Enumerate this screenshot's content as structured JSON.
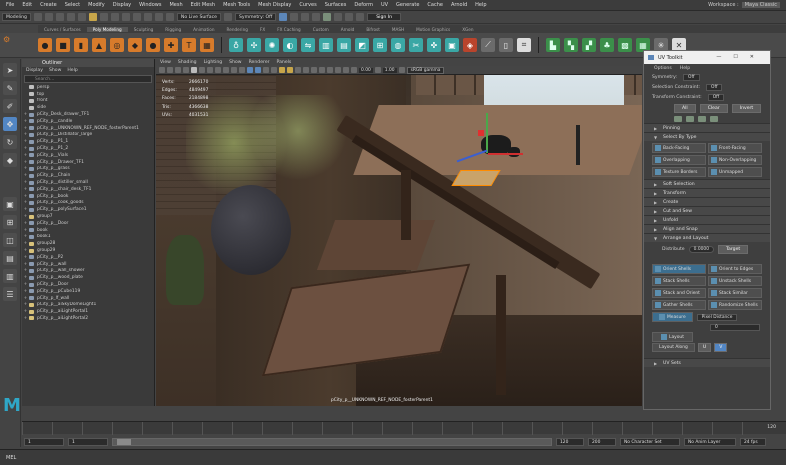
{
  "app": {
    "name": "Maya"
  },
  "menubar": [
    "File",
    "Edit",
    "Create",
    "Select",
    "Modify",
    "Display",
    "Windows",
    "Mesh",
    "Edit Mesh",
    "Mesh Tools",
    "Mesh Display",
    "Curves",
    "Surfaces",
    "Deform",
    "UV",
    "Generate",
    "Cache",
    "Arnold",
    "Help"
  ],
  "workspace": {
    "label": "Workspace :",
    "value": "Maya Classic"
  },
  "statusline": {
    "mode": "Modeling",
    "surface_mode": "No Live Surface",
    "symmetry": "Symmetry: Off",
    "sign_in": "Sign In"
  },
  "shelf": {
    "tabs": [
      "Curves / Surfaces",
      "Poly Modeling",
      "Sculpting",
      "Rigging",
      "Animation",
      "Rendering",
      "FX",
      "FX Caching",
      "Custom",
      "Arnold",
      "Bifrost",
      "MASH",
      "Motion Graphics",
      "XGen"
    ],
    "active_tab": "Poly Modeling"
  },
  "outliner": {
    "title": "Outliner",
    "menu": [
      "Display",
      "Show",
      "Help"
    ],
    "search_placeholder": "Search...",
    "items": [
      {
        "label": "persp",
        "type": "cam",
        "sel": false
      },
      {
        "label": "top",
        "type": "cam",
        "sel": false
      },
      {
        "label": "front",
        "type": "cam",
        "sel": false
      },
      {
        "label": "side",
        "type": "cam",
        "sel": false
      },
      {
        "label": "pCity_Desk_drawer_TF1",
        "type": "mesh",
        "sel": false
      },
      {
        "label": "pCity_p__candle",
        "type": "mesh",
        "sel": false
      },
      {
        "label": "pCity_p__UNKNOWN_REF_NODE_fosterParent1",
        "type": "mesh",
        "sel": false
      },
      {
        "label": "pCity_p__Distillator_large",
        "type": "mesh",
        "sel": false
      },
      {
        "label": "pCity_p__P1_1",
        "type": "mesh",
        "sel": false
      },
      {
        "label": "pCity_p__P1_2",
        "type": "mesh",
        "sel": false
      },
      {
        "label": "pCity_p__Vials",
        "type": "mesh",
        "sel": false
      },
      {
        "label": "pCity_p__Drawer_TF1",
        "type": "mesh",
        "sel": false
      },
      {
        "label": "pCity_p__grass",
        "type": "mesh",
        "sel": false
      },
      {
        "label": "pCity_p__Chain",
        "type": "mesh",
        "sel": false
      },
      {
        "label": "pCity_p__distiller_small",
        "type": "mesh",
        "sel": false
      },
      {
        "label": "pCity_p__chair_desk_TF1",
        "type": "mesh",
        "sel": false
      },
      {
        "label": "pCity_p__book",
        "type": "mesh",
        "sel": false
      },
      {
        "label": "pCity_p__cook_goods",
        "type": "mesh",
        "sel": false
      },
      {
        "label": "pCity_p__polySurface1",
        "type": "mesh",
        "sel": false
      },
      {
        "label": "group7",
        "type": "grp",
        "sel": false
      },
      {
        "label": "pCity_p__Door",
        "type": "mesh",
        "sel": false
      },
      {
        "label": "book",
        "type": "mesh",
        "sel": false
      },
      {
        "label": "book1",
        "type": "mesh",
        "sel": false
      },
      {
        "label": "group28",
        "type": "grp",
        "sel": false
      },
      {
        "label": "group29",
        "type": "grp",
        "sel": false
      },
      {
        "label": "pCity_p__P2",
        "type": "mesh",
        "sel": false
      },
      {
        "label": "pCity_p__wall",
        "type": "mesh",
        "sel": false
      },
      {
        "label": "pCity_p__wall_shower",
        "type": "mesh",
        "sel": false
      },
      {
        "label": "pCity_p__wood_plate",
        "type": "mesh",
        "sel": false
      },
      {
        "label": "pCity_p__Door",
        "type": "mesh",
        "sel": false
      },
      {
        "label": "pCity_p__pCube119",
        "type": "mesh",
        "sel": false
      },
      {
        "label": "pCity_p_lf_wall",
        "type": "mesh",
        "sel": false
      },
      {
        "label": "pCity_p__aiSkyDomeLight1",
        "type": "grp",
        "sel": false
      },
      {
        "label": "pCity_p__aiLightPortal1",
        "type": "grp",
        "sel": false
      },
      {
        "label": "pCity_p__aiLightPortal2",
        "type": "grp",
        "sel": false
      }
    ]
  },
  "viewport": {
    "menu": [
      "View",
      "Shading",
      "Lighting",
      "Show",
      "Renderer",
      "Panels"
    ],
    "hud": [
      {
        "label": "Verts:",
        "value": "2666170"
      },
      {
        "label": "Edges:",
        "value": "4849497"
      },
      {
        "label": "Faces:",
        "value": "2184898"
      },
      {
        "label": "Tris:",
        "value": "4366638"
      },
      {
        "label": "UVs:",
        "value": "4031531"
      }
    ],
    "field_a": "0.00",
    "field_b": "1.00",
    "color_space": "sRGB gamma",
    "caption": "pCity_p__UNKNOWN_REF_NODE_fosterParent1"
  },
  "uv_toolkit": {
    "title": "UV Toolkit",
    "menu": [
      "Options",
      "Help"
    ],
    "symmetry": {
      "label": "Symmetry:",
      "value": "Off"
    },
    "selection_constraint": {
      "label": "Selection Constraint:",
      "value": "Off"
    },
    "transform_constraint": {
      "label": "Transform Constraint:",
      "value": "Off"
    },
    "select_buttons": [
      "All",
      "Clear",
      "Invert"
    ],
    "sections": {
      "pinning": "Pinning",
      "select_by_type": "Select By Type",
      "soft_selection": "Soft Selection",
      "transform": "Transform",
      "create": "Create",
      "cut_and_sew": "Cut and Sew",
      "unfold": "Unfold",
      "align_and_snap": "Align and Snap",
      "arrange_and_layout": "Arrange and Layout",
      "uv_sets": "UV Sets"
    },
    "select_type_buttons": [
      "Back-Facing",
      "Front-Facing",
      "Overlapping",
      "Non-Overlapping",
      "Texture Borders",
      "Unmapped"
    ],
    "distribute": {
      "label": "Distribute",
      "value": "0.0000",
      "target": "Target"
    },
    "arrange_buttons": [
      "Orient Shells",
      "Orient to Edges",
      "Stack Shells",
      "Unstack Shells",
      "Stack and Orient",
      "Stack Similar",
      "Gather Shells",
      "Randomize Shells"
    ],
    "measure": {
      "label": "Measure",
      "value": "Pixel Distance",
      "result": "0"
    },
    "layout": "Layout",
    "layout_along": {
      "label": "Layout Along",
      "u": "U",
      "v": "V"
    }
  },
  "timeline": {
    "end_frame": "120",
    "range_start": "1",
    "current_start": "1",
    "range_end_a": "120",
    "range_end_b": "200",
    "character_set": "No Character Set",
    "anim_layer": "No Anim Layer",
    "fps": "24 fps"
  },
  "command_line": {
    "label": "MEL"
  },
  "colors": {
    "accent": "#5286c4",
    "shelf_orange": "#d77b2b",
    "logo": "#2fa7c7"
  }
}
